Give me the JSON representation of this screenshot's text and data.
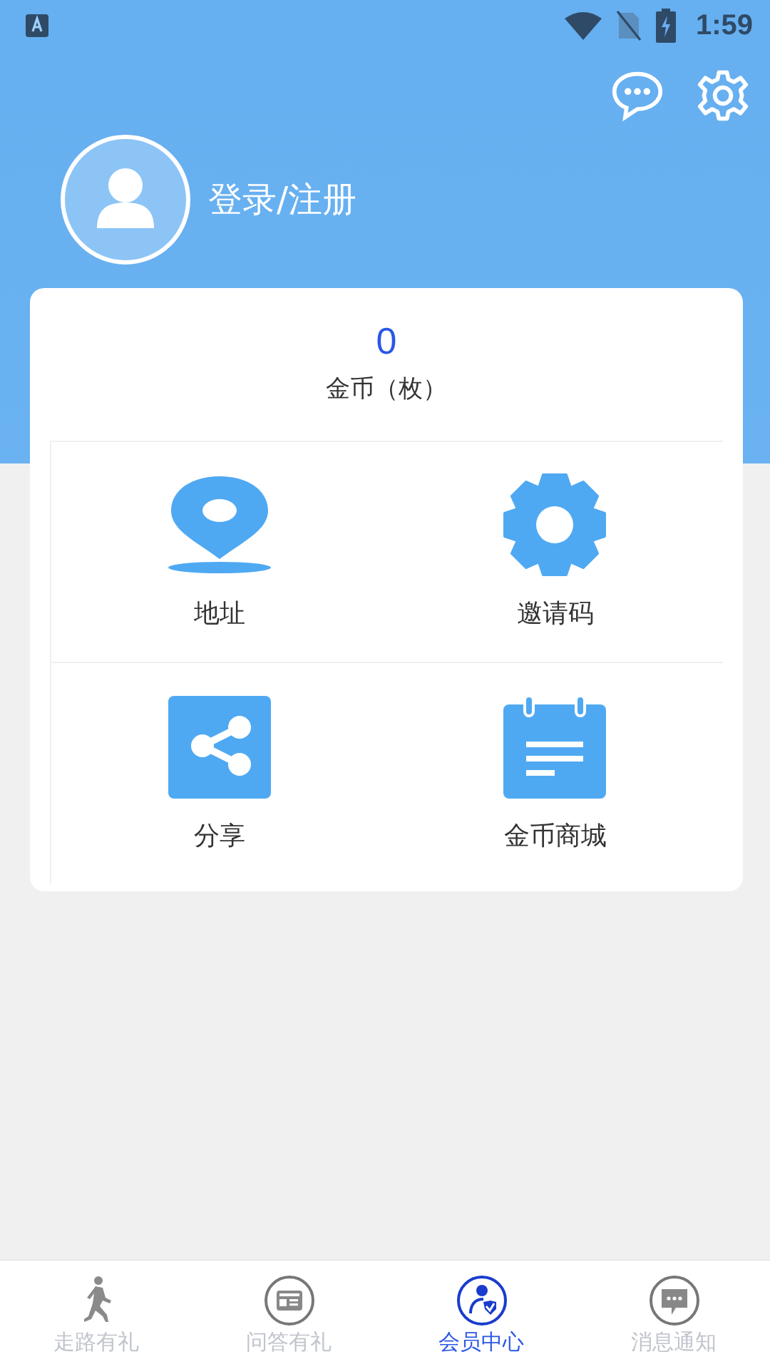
{
  "status_bar": {
    "time": "1:59"
  },
  "profile": {
    "login_label": "登录/注册"
  },
  "coins": {
    "value": "0",
    "label": "金币（枚）"
  },
  "features": [
    {
      "kind": "pin",
      "label": "地址"
    },
    {
      "kind": "gear",
      "label": "邀请码"
    },
    {
      "kind": "share",
      "label": "分享"
    },
    {
      "kind": "notepad",
      "label": "金币商城"
    }
  ],
  "tabs": [
    {
      "kind": "runner",
      "label": "走路有礼",
      "selected": false
    },
    {
      "kind": "card",
      "label": "问答有礼",
      "selected": false
    },
    {
      "kind": "member",
      "label": "会员中心",
      "selected": true
    },
    {
      "kind": "chat",
      "label": "消息通知",
      "selected": false
    }
  ]
}
